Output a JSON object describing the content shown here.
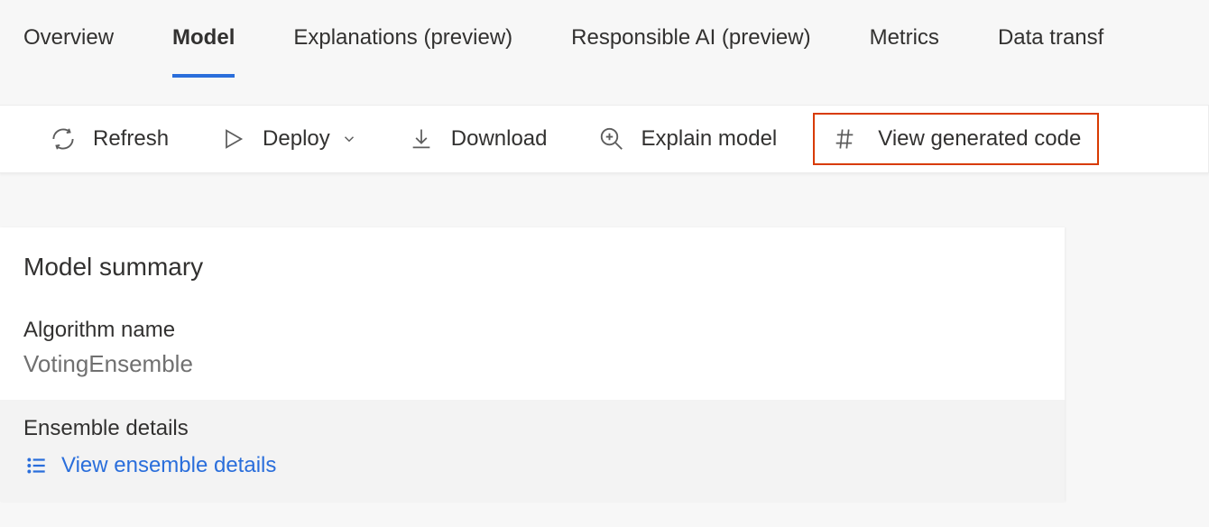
{
  "tabs": {
    "overview": "Overview",
    "model": "Model",
    "explanations": "Explanations (preview)",
    "responsible": "Responsible AI (preview)",
    "metrics": "Metrics",
    "datatransf": "Data transf"
  },
  "toolbar": {
    "refresh": "Refresh",
    "deploy": "Deploy",
    "download": "Download",
    "explain": "Explain model",
    "viewcode": "View generated code"
  },
  "summary": {
    "title": "Model summary",
    "algorithm_label": "Algorithm name",
    "algorithm_value": "VotingEnsemble",
    "ensemble_label": "Ensemble details",
    "ensemble_link": "View ensemble details"
  }
}
